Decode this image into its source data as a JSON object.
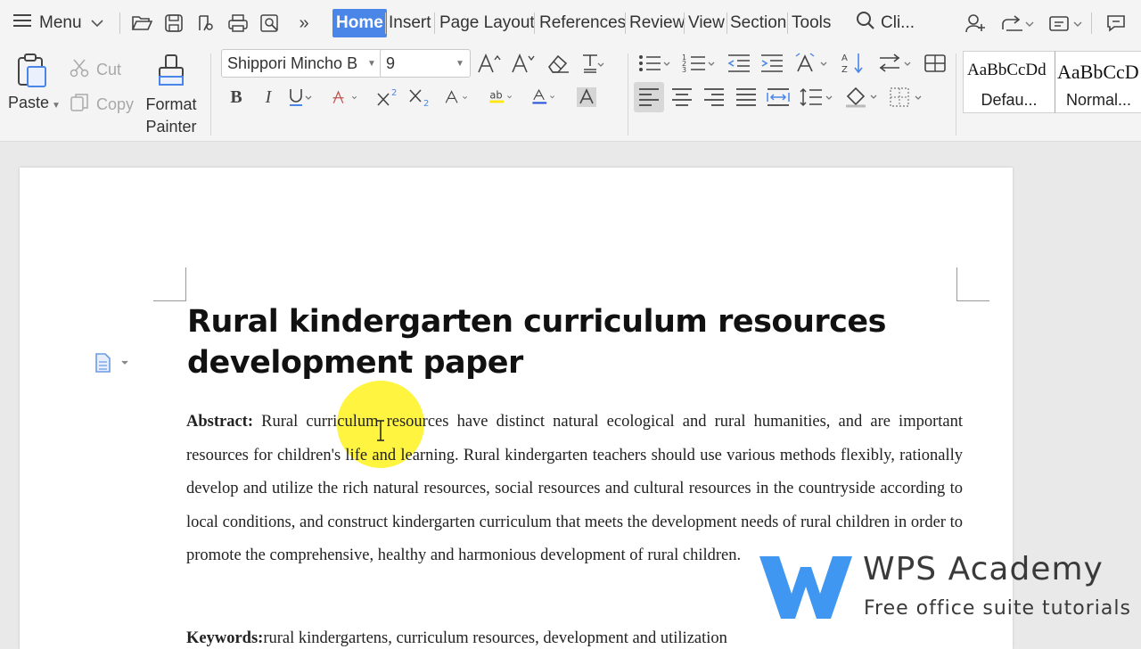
{
  "menu": {
    "label": "Menu"
  },
  "tabs": [
    {
      "label": "Home",
      "active": true
    },
    {
      "label": "Insert"
    },
    {
      "label": "Page Layout"
    },
    {
      "label": "References"
    },
    {
      "label": "Review"
    },
    {
      "label": "View"
    },
    {
      "label": "Section"
    },
    {
      "label": "Tools"
    }
  ],
  "search": {
    "text": "Cli..."
  },
  "ribbon": {
    "paste": "Paste",
    "cut": "Cut",
    "copy": "Copy",
    "format_painter_line1": "Format",
    "format_painter_line2": "Painter",
    "font_name": "Shippori Mincho B",
    "font_size": "9",
    "styles": [
      {
        "sample": "AaBbCcDd",
        "name": "Defau..."
      },
      {
        "sample": "AaBbCcD",
        "name": "Normal..."
      }
    ]
  },
  "document": {
    "title": "Rural kindergarten curriculum resources development paper",
    "abstract_label": "Abstract:",
    "abstract_text": "Rural curriculum resources have distinct natural ecological and rural humanities, and are important resources for children's life and learning. Rural kindergarten teachers should use various methods flexibly, rationally develop and utilize the rich natural resources, social resources and cultural resources in the countryside according to local conditions, and construct kindergarten curriculum that meets the development needs of rural children in order to promote the comprehensive, healthy and harmonious development of rural children.",
    "keywords_label": "Keywords:",
    "keywords_text": "rural kindergartens, curriculum resources, development and utilization"
  },
  "watermark": {
    "brand": "WPS Academy",
    "tagline": "Free office suite tutorials"
  },
  "colors": {
    "accent": "#4a86e8",
    "highlight": "#fff000",
    "logo_blue": "#2f8ef0"
  }
}
